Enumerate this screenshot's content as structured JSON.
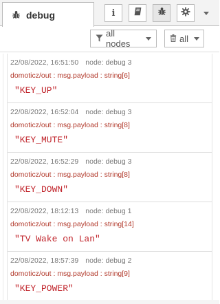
{
  "header": {
    "tab_label": "debug",
    "tab_icon": "bug-icon",
    "buttons": [
      {
        "name": "info-icon",
        "glyph": "i"
      },
      {
        "name": "book-icon"
      },
      {
        "name": "bug-icon"
      },
      {
        "name": "gear-icon"
      }
    ],
    "more_icon": "chevron-down-icon"
  },
  "toolbar": {
    "filter_label": "all nodes",
    "clear_label": "all"
  },
  "messages": [
    {
      "timestamp": "22/08/2022, 16:51:50",
      "node": "node: debug 3",
      "topic": "domoticz/out : msg.payload : string[6]",
      "payload": "\"KEY_UP\""
    },
    {
      "timestamp": "22/08/2022, 16:52:04",
      "node": "node: debug 3",
      "topic": "domoticz/out : msg.payload : string[8]",
      "payload": "\"KEY_MUTE\""
    },
    {
      "timestamp": "22/08/2022, 16:52:29",
      "node": "node: debug 3",
      "topic": "domoticz/out : msg.payload : string[8]",
      "payload": "\"KEY_DOWN\""
    },
    {
      "timestamp": "22/08/2022, 18:12:13",
      "node": "node: debug 1",
      "topic": "domoticz/out : msg.payload : string[14]",
      "payload": "\"TV Wake on Lan\""
    },
    {
      "timestamp": "22/08/2022, 18:57:39",
      "node": "node: debug 2",
      "topic": "domoticz/out : msg.payload : string[9]",
      "payload": "\"KEY_POWER\""
    }
  ],
  "colors": {
    "topic": "#b23a2c",
    "payload": "#c0232a",
    "meta": "#777777"
  }
}
